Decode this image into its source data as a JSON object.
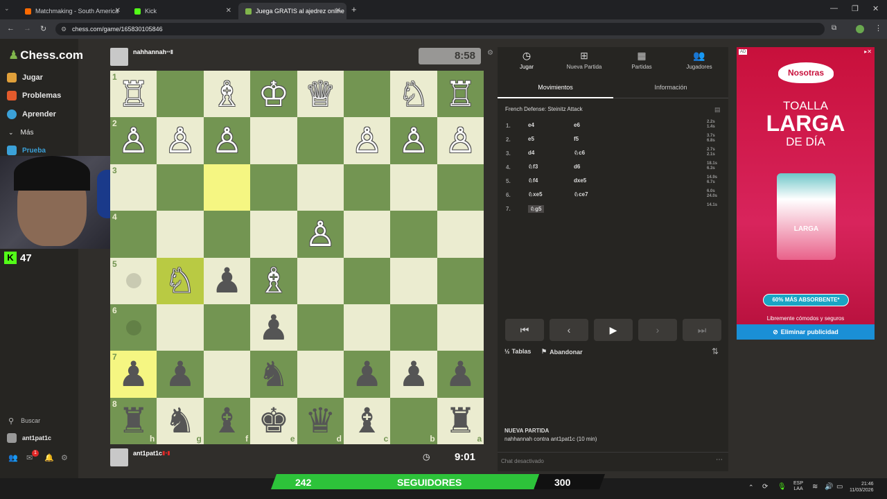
{
  "browser": {
    "tabs": [
      {
        "label": "Matchmaking - South America",
        "active": false
      },
      {
        "label": "Kick",
        "active": false
      },
      {
        "label": "Juega GRATIS al ajedrez online",
        "active": true
      }
    ],
    "url": "chess.com/game/165830105846"
  },
  "sidebar": {
    "brand": "Chess.com",
    "items": [
      {
        "label": "Jugar"
      },
      {
        "label": "Problemas"
      },
      {
        "label": "Aprender"
      },
      {
        "label": "Más"
      },
      {
        "label": "Prueba"
      }
    ],
    "search_label": "Buscar",
    "user": "ant1pat1c",
    "notification_count": "1"
  },
  "stream": {
    "kick_count": "47",
    "followers_current": "242",
    "followers_label": "SEGUIDORES",
    "followers_goal": "300"
  },
  "opponent": {
    "name": "nahhannah",
    "clock": "8:58"
  },
  "player": {
    "name": "ant1pat1c",
    "clock": "9:01"
  },
  "board": {
    "ranks": [
      "1",
      "2",
      "3",
      "4",
      "5",
      "6",
      "7",
      "8"
    ],
    "files": [
      "h",
      "g",
      "f",
      "e",
      "d",
      "c",
      "b",
      "a"
    ],
    "pieces": [
      [
        "♖",
        "",
        "♗",
        "♔",
        "♕",
        "",
        "♘",
        "♖"
      ],
      [
        "♙",
        "♙",
        "♙",
        "",
        "",
        "♙",
        "♙",
        "♙"
      ],
      [
        "",
        "",
        "",
        "",
        "",
        "",
        "",
        ""
      ],
      [
        "",
        "",
        "",
        "",
        "♙",
        "",
        "",
        ""
      ],
      [
        "",
        "♘",
        "♟",
        "♗",
        "",
        "",
        "",
        ""
      ],
      [
        "",
        "",
        "",
        "♟",
        "",
        "",
        "",
        ""
      ],
      [
        "♟",
        "♟",
        "",
        "♞",
        "",
        "♟",
        "♟",
        "♟"
      ],
      [
        "♜",
        "♞",
        "♝",
        "♚",
        "♛",
        "♝",
        "",
        "♜"
      ]
    ]
  },
  "panel": {
    "tabs": [
      {
        "label": "Jugar",
        "icon": "clock-icon"
      },
      {
        "label": "Nueva Partida",
        "icon": "plus-icon"
      },
      {
        "label": "Partidas",
        "icon": "grid-icon"
      },
      {
        "label": "Jugadores",
        "icon": "users-icon"
      }
    ],
    "subtabs": [
      "Movimientos",
      "Información"
    ],
    "opening": "French Defense: Steinitz Attack",
    "moves": [
      {
        "n": "1.",
        "w": "e4",
        "b": "e6",
        "tw": "2.2s",
        "tb": "1.4s"
      },
      {
        "n": "2.",
        "w": "e5",
        "b": "f5",
        "tw": "3.7s",
        "tb": "6.8s"
      },
      {
        "n": "3.",
        "w": "d4",
        "b": "♘c6",
        "tw": "2.7s",
        "tb": "2.1s"
      },
      {
        "n": "4.",
        "w": "♘f3",
        "b": "d6",
        "tw": "18.1s",
        "tb": "6.3s"
      },
      {
        "n": "5.",
        "w": "♘f4",
        "b": "dxe5",
        "tw": "14.9s",
        "tb": "6.7s"
      },
      {
        "n": "6.",
        "w": "♘xe5",
        "b": "♘ce7",
        "tw": "6.0s",
        "tb": "24.0s"
      },
      {
        "n": "7.",
        "w": "♘g5",
        "b": "",
        "tw": "14.1s",
        "tb": ""
      }
    ],
    "draw_label": "Tablas",
    "resign_label": "Abandonar",
    "game_title": "NUEVA PARTIDA",
    "game_desc": "nahhannah contra ant1pat1c (10 min)",
    "chat_placeholder": "Chat desactivado"
  },
  "ad": {
    "badge": "AD",
    "brand": "Nosotras",
    "line1": "TOALLA",
    "line2": "LARGA",
    "line3": "DE DÍA",
    "product": "LARGA",
    "claim": "60% MÁS ABSORBENTE*",
    "tagline": "Libremente cómodos y seguros",
    "remove_label": "Eliminar publicidad"
  },
  "taskbar": {
    "lang": "ESP",
    "lang2": "LAA",
    "time": "21:46",
    "date": "11/03/2026"
  },
  "colors": {
    "board_light": "#ebecd0",
    "board_dark": "#739552",
    "highlight": "#f5f682",
    "kick_green": "#53fc18"
  }
}
